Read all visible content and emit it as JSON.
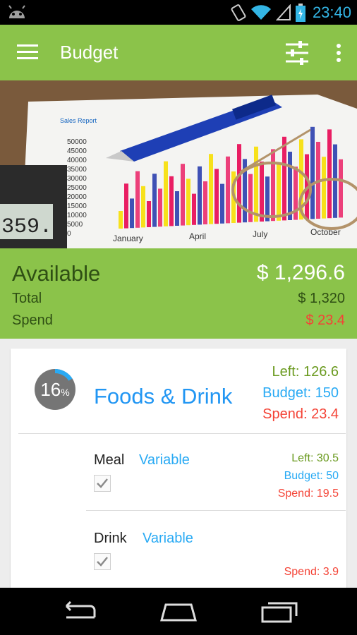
{
  "status_bar": {
    "time": "23:40",
    "icons": [
      "android-icon",
      "rotate-icon",
      "wifi-icon",
      "signal-icon",
      "battery-charging-icon"
    ]
  },
  "app_bar": {
    "title": "Budget",
    "icons": [
      "menu-icon",
      "filter-sliders-icon",
      "more-vert-icon"
    ]
  },
  "hero": {
    "report_title": "Sales Report",
    "y_ticks": [
      "50000",
      "45000",
      "40000",
      "35000",
      "30000",
      "25000",
      "20000",
      "15000",
      "10000",
      "5000",
      "0"
    ],
    "x_labels": [
      "January",
      "April",
      "July",
      "October"
    ],
    "calculator_display": "359."
  },
  "summary": {
    "available_label": "Available",
    "available_value": "$ 1,296.6",
    "total_label": "Total",
    "total_value": "$ 1,320",
    "spend_label": "Spend",
    "spend_value": "$ 23.4"
  },
  "category": {
    "percent": "16",
    "percent_sign": "%",
    "percent_fraction": 0.16,
    "name": "Foods & Drink",
    "left": "Left: 126.6",
    "budget": "Budget: 150",
    "spend": "Spend: 23.4",
    "items": [
      {
        "name": "Meal",
        "type": "Variable",
        "checked": true,
        "left": "Left: 30.5",
        "budget": "Budget: 50",
        "spend": "Spend: 19.5"
      },
      {
        "name": "Drink",
        "type": "Variable",
        "checked": true,
        "spend": "Spend: 3.9"
      }
    ]
  },
  "colors": {
    "primary": "#8bc34a",
    "blue": "#2196f3",
    "red": "#f44336",
    "green_text": "#6a9a1f",
    "status_blue": "#33b5e5"
  },
  "nav_bar": {
    "icons": [
      "back-icon",
      "home-icon",
      "recents-icon"
    ]
  }
}
